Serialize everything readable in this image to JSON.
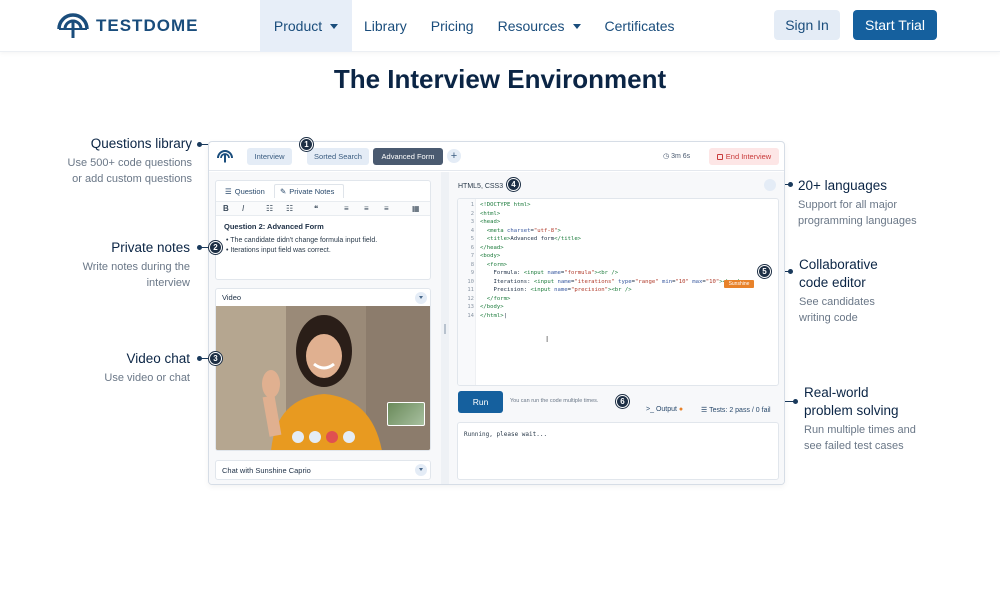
{
  "brand": {
    "name": "TESTDOME",
    "primary_color": "#15609e",
    "dark_color": "#0b2545"
  },
  "nav": {
    "items": [
      {
        "label": "Product",
        "has_caret": true,
        "active": true
      },
      {
        "label": "Library"
      },
      {
        "label": "Pricing"
      },
      {
        "label": "Resources",
        "has_caret": true
      },
      {
        "label": "Certificates"
      }
    ],
    "sign_in": "Sign In",
    "start_trial": "Start Trial"
  },
  "page": {
    "title": "The Interview Environment"
  },
  "annotations": [
    {
      "num": "1",
      "title": "Questions library",
      "desc_lines": [
        "Use 500+ code questions",
        "or add custom questions"
      ]
    },
    {
      "num": "2",
      "title": "Private notes",
      "desc_lines": [
        "Write notes during the",
        "interview"
      ]
    },
    {
      "num": "3",
      "title": "Video chat",
      "desc_lines": [
        "Use video or chat"
      ]
    },
    {
      "num": "4",
      "title": "20+ languages",
      "desc_lines": [
        "Support for all major",
        "programming languages"
      ]
    },
    {
      "num": "5",
      "title_lines": [
        "Collaborative",
        "code editor"
      ],
      "desc_lines": [
        "See candidates",
        "writing code"
      ]
    },
    {
      "num": "6",
      "title_lines": [
        "Real-world",
        "problem solving"
      ],
      "desc_lines": [
        "Run multiple times and",
        "see failed test cases"
      ]
    }
  ],
  "app": {
    "tabs": [
      "Interview",
      "Sorted Search",
      "Advanced Form"
    ],
    "active_tab": "Advanced Form",
    "add_tab": "+",
    "timer": "3m 6s",
    "end_interview": "End Interview",
    "notes": {
      "tabs": [
        "Question",
        "Private Notes"
      ],
      "question_title": "Question 2: Advanced Form",
      "bullets": [
        "The candidate didn't change formula input field.",
        "Iterations input field was correct."
      ]
    },
    "video": {
      "label": "Video"
    },
    "chat": {
      "label": "Chat with Sunshine Caprio"
    },
    "editor": {
      "language": "HTML5, CSS3",
      "line_numbers": [
        "1",
        "2",
        "3",
        "4",
        "5",
        "6",
        "7",
        "8",
        "9",
        "10",
        "11",
        "12",
        "13",
        "14"
      ],
      "collaborator_tag": "Sunshine"
    },
    "run": {
      "label": "Run",
      "hint": "You can run the code multiple times."
    },
    "output": {
      "tab_output": "Output",
      "tab_tests": "Tests: 2 pass / 0 fail",
      "text": "Running, please wait..."
    }
  }
}
